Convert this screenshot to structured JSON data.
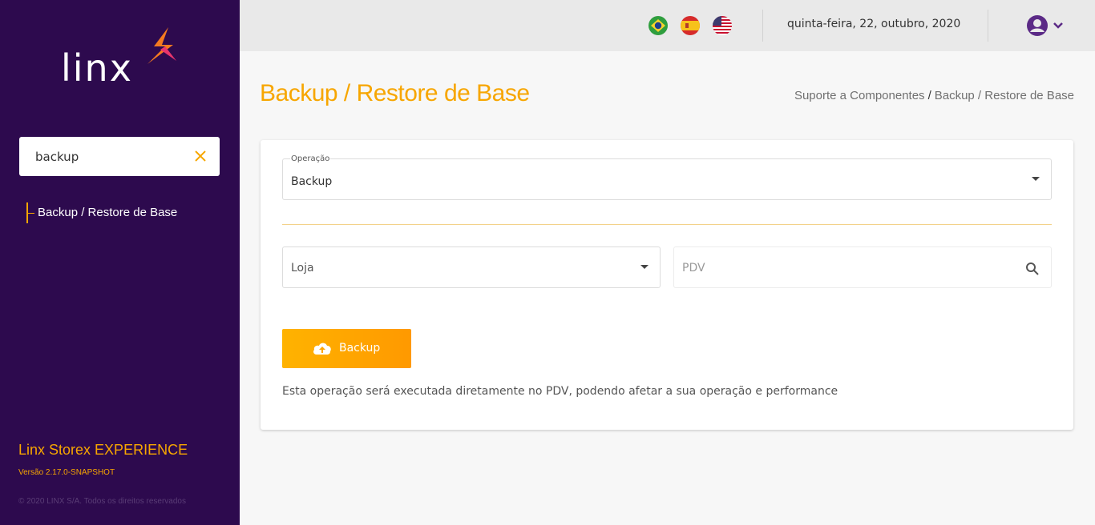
{
  "sidebar": {
    "logo_text": "linx",
    "search": {
      "value": "backup"
    },
    "items": [
      {
        "label": "Backup / Restore de Base"
      }
    ],
    "brand": "Linx Storex EXPERIENCE",
    "version": "Versão 2.17.0-SNAPSHOT",
    "copyright": "© 2020 LINX S/A. Todos os direitos reservados"
  },
  "header": {
    "languages": [
      "pt-BR flag",
      "es flag",
      "en-US flag"
    ],
    "date": "quinta-feira, 22, outubro, 2020"
  },
  "page": {
    "title": "Backup / Restore de Base",
    "breadcrumb": {
      "parent": "Suporte a Componentes",
      "separator": "/",
      "current": "Backup / Restore de Base"
    }
  },
  "form": {
    "operation": {
      "label": "Operação",
      "value": "Backup"
    },
    "store": {
      "value": "Loja"
    },
    "pdv": {
      "placeholder": "PDV"
    },
    "button_label": "Backup",
    "note": "Esta operação será executada diretamente no PDV, podendo afetar a sua operação e performance"
  },
  "colors": {
    "sidebar": "#2d0a4e",
    "accent": "#f7a600",
    "button": "#ffa500"
  }
}
